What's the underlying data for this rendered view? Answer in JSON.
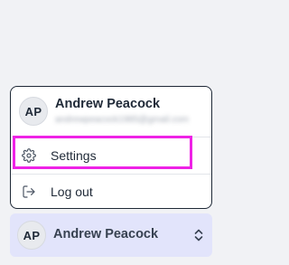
{
  "menu": {
    "user": {
      "initials": "AP",
      "name": "Andrew Peacock",
      "email": "andrewpeacock1985@gmail.com"
    },
    "items": [
      {
        "label": "Settings",
        "icon": "gear-icon"
      },
      {
        "label": "Log out",
        "icon": "logout-icon"
      }
    ]
  },
  "account_bar": {
    "initials": "AP",
    "name": "Andrew Peacock",
    "icon": "chevron-up-down-icon"
  },
  "colors": {
    "highlight": "#ee22e6",
    "account_bar_bg": "#e2e4fb",
    "page_bg": "#f1f2f5"
  }
}
